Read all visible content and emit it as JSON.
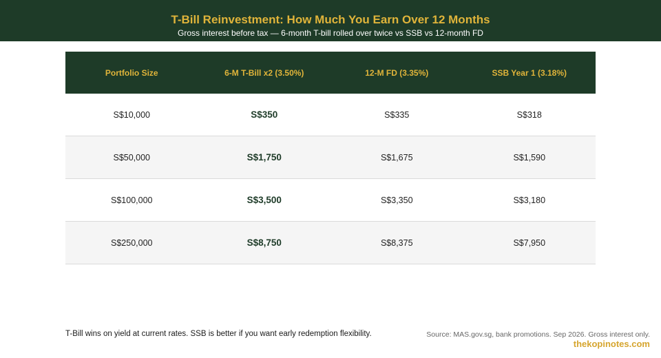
{
  "header": {
    "title": "T-Bill Reinvestment: How Much You Earn Over 12 Months",
    "subtitle": "Gross interest before tax — 6-month T-bill rolled over twice vs SSB vs 12-month FD"
  },
  "table": {
    "columns": [
      "Portfolio Size",
      "6-M T-Bill x2 (3.50%)",
      "12-M FD (3.35%)",
      "SSB Year 1 (3.18%)"
    ],
    "rows": [
      [
        "S$10,000",
        "S$350",
        "S$335",
        "S$318"
      ],
      [
        "S$50,000",
        "S$1,750",
        "S$1,675",
        "S$1,590"
      ],
      [
        "S$100,000",
        "S$3,500",
        "S$3,350",
        "S$3,180"
      ],
      [
        "S$250,000",
        "S$8,750",
        "S$8,375",
        "S$7,950"
      ]
    ],
    "highlight_column_index": 1
  },
  "footer": {
    "note": "T-Bill wins on yield at current rates. SSB is better if you want early redemption flexibility.",
    "source": "Source: MAS.gov.sg, bank promotions. Sep 2026. Gross interest only.",
    "brand": "thekopinotes.com"
  },
  "colors": {
    "header_bg": "#1e3b28",
    "accent_gold": "#e0b43a",
    "highlight_text": "#1e3b28",
    "stripe_bg": "#f5f5f5"
  }
}
